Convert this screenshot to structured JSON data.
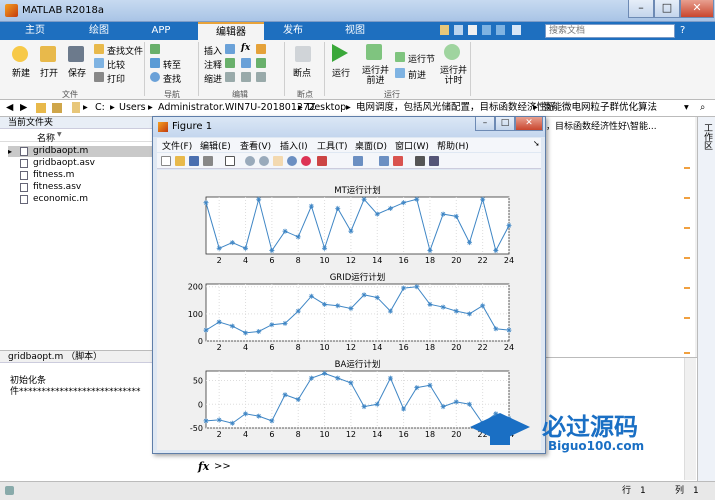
{
  "app": {
    "title": "MATLAB R2018a"
  },
  "tabs": [
    {
      "label": "主页"
    },
    {
      "label": "绘图"
    },
    {
      "label": "APP"
    },
    {
      "label": "编辑器"
    },
    {
      "label": "发布"
    },
    {
      "label": "视图"
    }
  ],
  "search": {
    "placeholder": "搜索文档"
  },
  "ribbon": {
    "new": "新建",
    "open": "打开",
    "save": "保存",
    "find_files": "查找文件",
    "compare": "比较",
    "print": "打印",
    "goto": "转至",
    "find": "查找",
    "insert": "插入",
    "fx": "fx",
    "comment": "注释",
    "indent": "缩进",
    "breakpoint": "断点",
    "run": "运行",
    "run_advance": "运行并\n前进",
    "run_section": "运行节",
    "advance": "前进",
    "run_time": "运行并\n计时",
    "groups": {
      "file": "文件",
      "navigate": "导航",
      "edit": "编辑",
      "breakpoints": "断点",
      "run": "运行"
    }
  },
  "path": {
    "segments": [
      "C:",
      "Users",
      "Administrator.WIN7U-20180127Z",
      "Desktop",
      "电网调度，包括风光储配置，目标函数经济性好",
      "智能微电网粒子群优化算法"
    ],
    "right_overflow": "，目标函数经济性好\\智能..."
  },
  "current_folder": {
    "header": "当前文件夹",
    "col_name": "名称",
    "sort_arrow": "▼",
    "files": [
      {
        "name": "gridbaopt.m"
      },
      {
        "name": "gridbaopt.asv"
      },
      {
        "name": "fitness.m"
      },
      {
        "name": "fitness.asv"
      },
      {
        "name": "economic.m"
      }
    ]
  },
  "details": {
    "header": "gridbaopt.m （脚本）",
    "line1": "初始化条",
    "line2": "件***************************"
  },
  "workspace": {
    "label": "工作区"
  },
  "command": {
    "prompt_icon": "fx",
    "prompt": ">>"
  },
  "status": {
    "row_label": "行",
    "row": "1",
    "col_label": "列",
    "col": "1"
  },
  "figure": {
    "title": "Figure 1",
    "menu": [
      "文件(F)",
      "编辑(E)",
      "查看(V)",
      "插入(I)",
      "工具(T)",
      "桌面(D)",
      "窗口(W)",
      "帮助(H)"
    ]
  },
  "colors": {
    "plot_line": "#3f86c5",
    "tabbar": "#1e6fbf",
    "accent": "#e8a33a"
  },
  "chart_data": [
    {
      "type": "line",
      "title": "MT运行计划",
      "x": [
        1,
        2,
        3,
        4,
        5,
        6,
        7,
        8,
        9,
        10,
        11,
        12,
        13,
        14,
        15,
        16,
        17,
        18,
        19,
        20,
        21,
        22,
        23,
        24
      ],
      "series": [
        {
          "values": [
            45,
            5,
            10,
            5,
            48,
            3,
            20,
            15,
            42,
            5,
            40,
            20,
            48,
            35,
            40,
            45,
            48,
            3,
            35,
            33,
            10,
            48,
            3,
            25
          ]
        }
      ],
      "xticks": [
        2,
        4,
        6,
        8,
        10,
        12,
        14,
        16,
        18,
        20,
        22,
        24
      ],
      "xlim": [
        1,
        24
      ],
      "ylim": [
        0,
        50
      ]
    },
    {
      "type": "line",
      "title": "GRID运行计划",
      "x": [
        1,
        2,
        3,
        4,
        5,
        6,
        7,
        8,
        9,
        10,
        11,
        12,
        13,
        14,
        15,
        16,
        17,
        18,
        19,
        20,
        21,
        22,
        23,
        24
      ],
      "series": [
        {
          "values": [
            40,
            70,
            55,
            30,
            35,
            60,
            65,
            110,
            165,
            135,
            130,
            120,
            170,
            160,
            110,
            195,
            200,
            135,
            125,
            110,
            100,
            130,
            45,
            40
          ]
        }
      ],
      "xticks": [
        2,
        4,
        6,
        8,
        10,
        12,
        14,
        16,
        18,
        20,
        22,
        24
      ],
      "yticks": [
        0,
        100,
        200
      ],
      "xlim": [
        1,
        24
      ],
      "ylim": [
        0,
        210
      ]
    },
    {
      "type": "line",
      "title": "BA运行计划",
      "x": [
        1,
        2,
        3,
        4,
        5,
        6,
        7,
        8,
        9,
        10,
        11,
        12,
        13,
        14,
        15,
        16,
        17,
        18,
        19,
        20,
        21,
        22,
        23,
        24
      ],
      "series": [
        {
          "values": [
            -35,
            -33,
            -40,
            -20,
            -25,
            -35,
            20,
            10,
            55,
            65,
            55,
            45,
            -5,
            0,
            55,
            -10,
            35,
            40,
            -5,
            5,
            0,
            -40,
            -20,
            -30
          ]
        }
      ],
      "xticks": [
        2,
        4,
        6,
        8,
        10,
        12,
        14,
        16,
        18,
        20,
        22,
        24
      ],
      "yticks": [
        -50,
        0,
        50
      ],
      "xlim": [
        1,
        24
      ],
      "ylim": [
        -50,
        70
      ]
    }
  ],
  "watermark": {
    "cn": "必过源码",
    "url": "Biguo100.com"
  }
}
